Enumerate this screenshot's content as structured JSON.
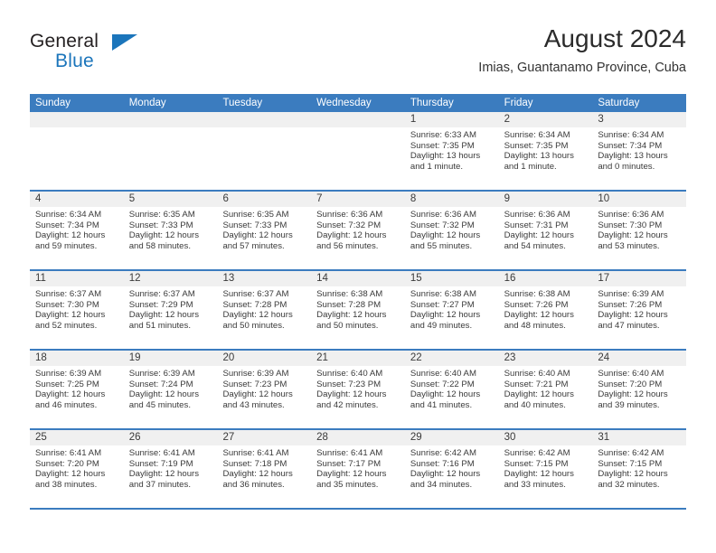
{
  "brand": {
    "line1": "General",
    "line2": "Blue",
    "triangle_color": "#1b75bb"
  },
  "header": {
    "title": "August 2024",
    "subtitle": "Imias, Guantanamo Province, Cuba"
  },
  "theme": {
    "header_blue": "#3b7cbf",
    "datebar_gray": "#f0f0f0",
    "text": "#3a3a3a"
  },
  "weekdays": [
    "Sunday",
    "Monday",
    "Tuesday",
    "Wednesday",
    "Thursday",
    "Friday",
    "Saturday"
  ],
  "weeks": [
    [
      {
        "day": "",
        "sunrise": "",
        "sunset": "",
        "daylight": "",
        "empty": true
      },
      {
        "day": "",
        "sunrise": "",
        "sunset": "",
        "daylight": "",
        "empty": true
      },
      {
        "day": "",
        "sunrise": "",
        "sunset": "",
        "daylight": "",
        "empty": true
      },
      {
        "day": "",
        "sunrise": "",
        "sunset": "",
        "daylight": "",
        "empty": true
      },
      {
        "day": "1",
        "sunrise": "Sunrise: 6:33 AM",
        "sunset": "Sunset: 7:35 PM",
        "daylight": "Daylight: 13 hours and 1 minute."
      },
      {
        "day": "2",
        "sunrise": "Sunrise: 6:34 AM",
        "sunset": "Sunset: 7:35 PM",
        "daylight": "Daylight: 13 hours and 1 minute."
      },
      {
        "day": "3",
        "sunrise": "Sunrise: 6:34 AM",
        "sunset": "Sunset: 7:34 PM",
        "daylight": "Daylight: 13 hours and 0 minutes."
      }
    ],
    [
      {
        "day": "4",
        "sunrise": "Sunrise: 6:34 AM",
        "sunset": "Sunset: 7:34 PM",
        "daylight": "Daylight: 12 hours and 59 minutes."
      },
      {
        "day": "5",
        "sunrise": "Sunrise: 6:35 AM",
        "sunset": "Sunset: 7:33 PM",
        "daylight": "Daylight: 12 hours and 58 minutes."
      },
      {
        "day": "6",
        "sunrise": "Sunrise: 6:35 AM",
        "sunset": "Sunset: 7:33 PM",
        "daylight": "Daylight: 12 hours and 57 minutes."
      },
      {
        "day": "7",
        "sunrise": "Sunrise: 6:36 AM",
        "sunset": "Sunset: 7:32 PM",
        "daylight": "Daylight: 12 hours and 56 minutes."
      },
      {
        "day": "8",
        "sunrise": "Sunrise: 6:36 AM",
        "sunset": "Sunset: 7:32 PM",
        "daylight": "Daylight: 12 hours and 55 minutes."
      },
      {
        "day": "9",
        "sunrise": "Sunrise: 6:36 AM",
        "sunset": "Sunset: 7:31 PM",
        "daylight": "Daylight: 12 hours and 54 minutes."
      },
      {
        "day": "10",
        "sunrise": "Sunrise: 6:36 AM",
        "sunset": "Sunset: 7:30 PM",
        "daylight": "Daylight: 12 hours and 53 minutes."
      }
    ],
    [
      {
        "day": "11",
        "sunrise": "Sunrise: 6:37 AM",
        "sunset": "Sunset: 7:30 PM",
        "daylight": "Daylight: 12 hours and 52 minutes."
      },
      {
        "day": "12",
        "sunrise": "Sunrise: 6:37 AM",
        "sunset": "Sunset: 7:29 PM",
        "daylight": "Daylight: 12 hours and 51 minutes."
      },
      {
        "day": "13",
        "sunrise": "Sunrise: 6:37 AM",
        "sunset": "Sunset: 7:28 PM",
        "daylight": "Daylight: 12 hours and 50 minutes."
      },
      {
        "day": "14",
        "sunrise": "Sunrise: 6:38 AM",
        "sunset": "Sunset: 7:28 PM",
        "daylight": "Daylight: 12 hours and 50 minutes."
      },
      {
        "day": "15",
        "sunrise": "Sunrise: 6:38 AM",
        "sunset": "Sunset: 7:27 PM",
        "daylight": "Daylight: 12 hours and 49 minutes."
      },
      {
        "day": "16",
        "sunrise": "Sunrise: 6:38 AM",
        "sunset": "Sunset: 7:26 PM",
        "daylight": "Daylight: 12 hours and 48 minutes."
      },
      {
        "day": "17",
        "sunrise": "Sunrise: 6:39 AM",
        "sunset": "Sunset: 7:26 PM",
        "daylight": "Daylight: 12 hours and 47 minutes."
      }
    ],
    [
      {
        "day": "18",
        "sunrise": "Sunrise: 6:39 AM",
        "sunset": "Sunset: 7:25 PM",
        "daylight": "Daylight: 12 hours and 46 minutes."
      },
      {
        "day": "19",
        "sunrise": "Sunrise: 6:39 AM",
        "sunset": "Sunset: 7:24 PM",
        "daylight": "Daylight: 12 hours and 45 minutes."
      },
      {
        "day": "20",
        "sunrise": "Sunrise: 6:39 AM",
        "sunset": "Sunset: 7:23 PM",
        "daylight": "Daylight: 12 hours and 43 minutes."
      },
      {
        "day": "21",
        "sunrise": "Sunrise: 6:40 AM",
        "sunset": "Sunset: 7:23 PM",
        "daylight": "Daylight: 12 hours and 42 minutes."
      },
      {
        "day": "22",
        "sunrise": "Sunrise: 6:40 AM",
        "sunset": "Sunset: 7:22 PM",
        "daylight": "Daylight: 12 hours and 41 minutes."
      },
      {
        "day": "23",
        "sunrise": "Sunrise: 6:40 AM",
        "sunset": "Sunset: 7:21 PM",
        "daylight": "Daylight: 12 hours and 40 minutes."
      },
      {
        "day": "24",
        "sunrise": "Sunrise: 6:40 AM",
        "sunset": "Sunset: 7:20 PM",
        "daylight": "Daylight: 12 hours and 39 minutes."
      }
    ],
    [
      {
        "day": "25",
        "sunrise": "Sunrise: 6:41 AM",
        "sunset": "Sunset: 7:20 PM",
        "daylight": "Daylight: 12 hours and 38 minutes."
      },
      {
        "day": "26",
        "sunrise": "Sunrise: 6:41 AM",
        "sunset": "Sunset: 7:19 PM",
        "daylight": "Daylight: 12 hours and 37 minutes."
      },
      {
        "day": "27",
        "sunrise": "Sunrise: 6:41 AM",
        "sunset": "Sunset: 7:18 PM",
        "daylight": "Daylight: 12 hours and 36 minutes."
      },
      {
        "day": "28",
        "sunrise": "Sunrise: 6:41 AM",
        "sunset": "Sunset: 7:17 PM",
        "daylight": "Daylight: 12 hours and 35 minutes."
      },
      {
        "day": "29",
        "sunrise": "Sunrise: 6:42 AM",
        "sunset": "Sunset: 7:16 PM",
        "daylight": "Daylight: 12 hours and 34 minutes."
      },
      {
        "day": "30",
        "sunrise": "Sunrise: 6:42 AM",
        "sunset": "Sunset: 7:15 PM",
        "daylight": "Daylight: 12 hours and 33 minutes."
      },
      {
        "day": "31",
        "sunrise": "Sunrise: 6:42 AM",
        "sunset": "Sunset: 7:15 PM",
        "daylight": "Daylight: 12 hours and 32 minutes."
      }
    ]
  ]
}
